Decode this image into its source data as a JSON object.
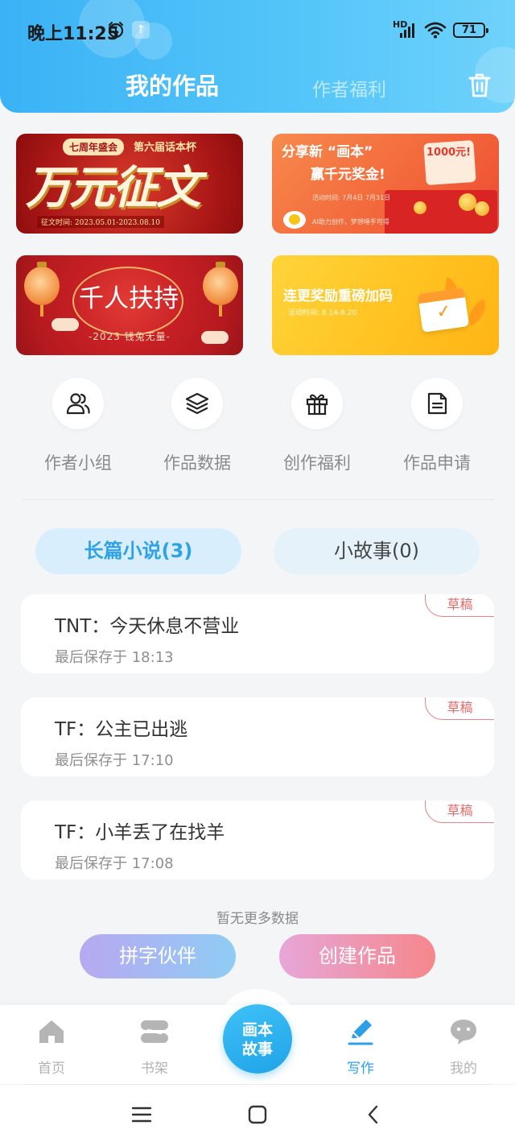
{
  "status_bar": {
    "time": "晚上11:25",
    "hd": "HD",
    "battery": "71",
    "upload_badge": "↑"
  },
  "header": {
    "tab_works": "我的作品",
    "tab_welfare": "作者福利"
  },
  "banners": {
    "b1": {
      "tag": "七周年盛会",
      "cup": "第六届话本杯",
      "big": "万元征文",
      "date": "征文时间: 2023.05.01-2023.08.10"
    },
    "b2": {
      "title": "分享新 “画本”",
      "sub": "赢千元奖金!",
      "prize": "1000元!",
      "time": "活动时间: 7月4日 7月31日",
      "foot": "AI助力创作，梦想唾手可得"
    },
    "b3": {
      "title": "千人扶持",
      "sub": "-2023 钱兔无量-"
    },
    "b4": {
      "title": "连更奖励重磅加码",
      "time": "活动时间: 8.14-8.20"
    }
  },
  "quick_actions": [
    {
      "label": "作者小组",
      "icon": "users-icon"
    },
    {
      "label": "作品数据",
      "icon": "layers-icon"
    },
    {
      "label": "创作福利",
      "icon": "gift-icon"
    },
    {
      "label": "作品申请",
      "icon": "document-icon"
    }
  ],
  "segments": {
    "novels": "长篇小说(3)",
    "stories": "小故事(0)"
  },
  "works": [
    {
      "title": "TNT：今天休息不营业",
      "time": "最后保存于 18:13",
      "badge": "草稿"
    },
    {
      "title": "TF：公主已出逃",
      "time": "最后保存于 17:10",
      "badge": "草稿"
    },
    {
      "title": "TF：小羊丢了在找羊",
      "time": "最后保存于 17:08",
      "badge": "草稿"
    }
  ],
  "no_more": "暂无更多数据",
  "actions": {
    "partner": "拼字伙伴",
    "create": "创建作品"
  },
  "bottom_nav": {
    "home": "首页",
    "shelf": "书架",
    "center": "画本\n故事",
    "center_line1": "画本",
    "center_line2": "故事",
    "write": "写作",
    "mine": "我的"
  },
  "colors": {
    "accent": "#2c9fe8",
    "header_start": "#3ab2f5",
    "draft": "#e06a6a"
  }
}
